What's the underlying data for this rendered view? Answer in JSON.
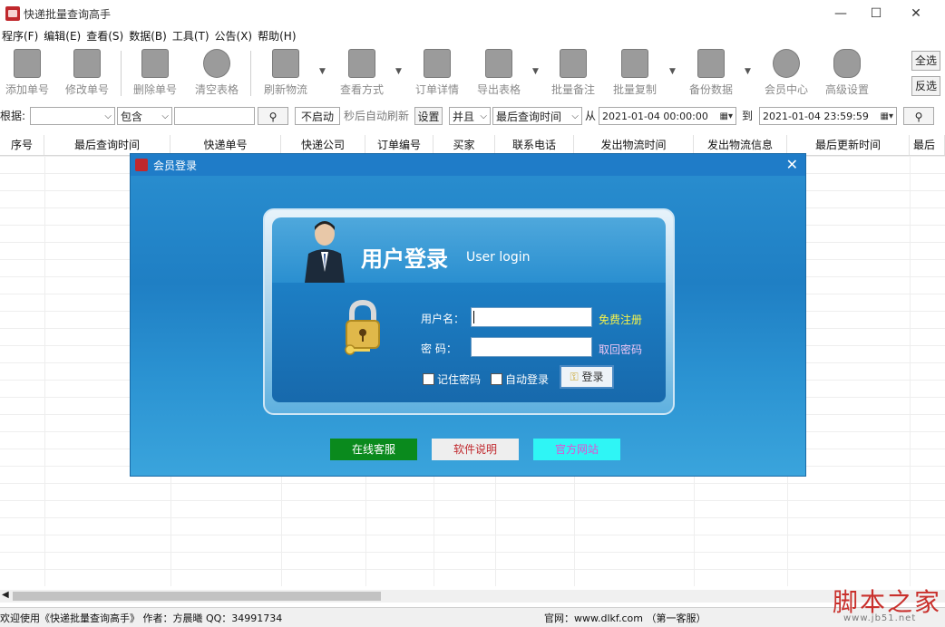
{
  "window": {
    "title": "快递批量查询高手",
    "min": "—",
    "max": "☐",
    "close": "✕"
  },
  "menu": [
    "程序(F)",
    "编辑(E)",
    "查看(S)",
    "数据(B)",
    "工具(T)",
    "公告(X)",
    "帮助(H)"
  ],
  "toolbar": {
    "add": "添加单号",
    "edit": "修改单号",
    "delete": "删除单号",
    "clear": "清空表格",
    "refresh": "刷新物流",
    "view": "查看方式",
    "detail": "订单详情",
    "export": "导出表格",
    "batch_note": "批量备注",
    "batch_copy": "批量复制",
    "backup": "备份数据",
    "member": "会员中心",
    "advanced": "高级设置",
    "select_all": "全选",
    "invert": "反选"
  },
  "filter": {
    "label": "根据:",
    "field_value": "",
    "op_value": "包含",
    "keyword": "",
    "auto_btn": "不启动",
    "auto_text": "秒后自动刷新",
    "set_btn": "设置",
    "logic": "并且",
    "time_field": "最后查询时间",
    "from_label": "从",
    "from": "2021-01-04 00:00:00",
    "to_label": "到",
    "to": "2021-01-04 23:59:59"
  },
  "columns": [
    "序号",
    "最后查询时间",
    "快递单号",
    "快递公司",
    "订单编号",
    "买家",
    "联系电话",
    "发出物流时间",
    "发出物流信息",
    "最后更新时间",
    "最后"
  ],
  "dialog": {
    "title": "会员登录",
    "heading": "用户登录",
    "heading_en": "User login",
    "username_label": "用户名：",
    "password_label": "密  码：",
    "register_link": "免费注册",
    "recover_link": "取回密码",
    "remember": "记住密码",
    "auto_login": "自动登录",
    "login_btn": "登录",
    "online_service": "在线客服",
    "software_info": "软件说明",
    "official_site": "官方网站"
  },
  "status": {
    "welcome": "欢迎使用《快递批量查询高手》 作者：方晨曦  QQ：34991734",
    "site": "官网：www.dlkf.com （第一客服）"
  },
  "watermark": {
    "main": "脚本之家",
    "sub": "www.jb51.net"
  },
  "colors": {
    "dialog_blue": "#1f7cc8",
    "link_yellow": "#f7f34a",
    "link_pink": "#f0c7f5",
    "service_green": "#0a8a1d",
    "site_cyan": "#2ff5f5"
  }
}
